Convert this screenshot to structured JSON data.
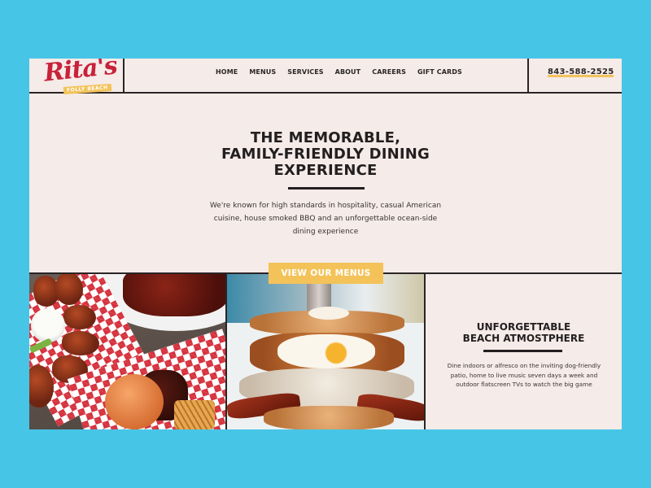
{
  "colors": {
    "background": "#47c5e6",
    "page": "#f5ebe8",
    "ink": "#231f20",
    "accent_yellow": "#f3c35a",
    "logo_red": "#c8213a"
  },
  "header": {
    "logo": {
      "script": "Rita's",
      "tagline": "FOLLY BEACH"
    },
    "nav": [
      {
        "label": "HOME"
      },
      {
        "label": "MENUS"
      },
      {
        "label": "SERVICES"
      },
      {
        "label": "ABOUT"
      },
      {
        "label": "CAREERS"
      },
      {
        "label": "GIFT CARDS"
      }
    ],
    "phone": "843-588-2525"
  },
  "hero": {
    "title_lines": [
      "THE MEMORABLE,",
      "FAMILY-FRIENDLY DINING",
      "EXPERIENCE"
    ],
    "body": "We're known for high standards in hospitality, casual American cuisine, house smoked BBQ and an unforgettable ocean-side dining experience",
    "cta_label": "VIEW OUR MENUS"
  },
  "panels": {
    "bbq_photo": "wings, ribs and pulled pork sandwich in checkered baskets",
    "breakfast_photo": "chicken and pancake stack with egg, gravy and bacon",
    "atmosphere": {
      "title_lines": [
        "UNFORGETTABLE",
        "BEACH ATMOSTPHERE"
      ],
      "body": "Dine indoors or alfresco on the inviting dog-friendly patio, home to live music seven days a week and outdoor flatscreen TVs to watch the big game"
    }
  }
}
